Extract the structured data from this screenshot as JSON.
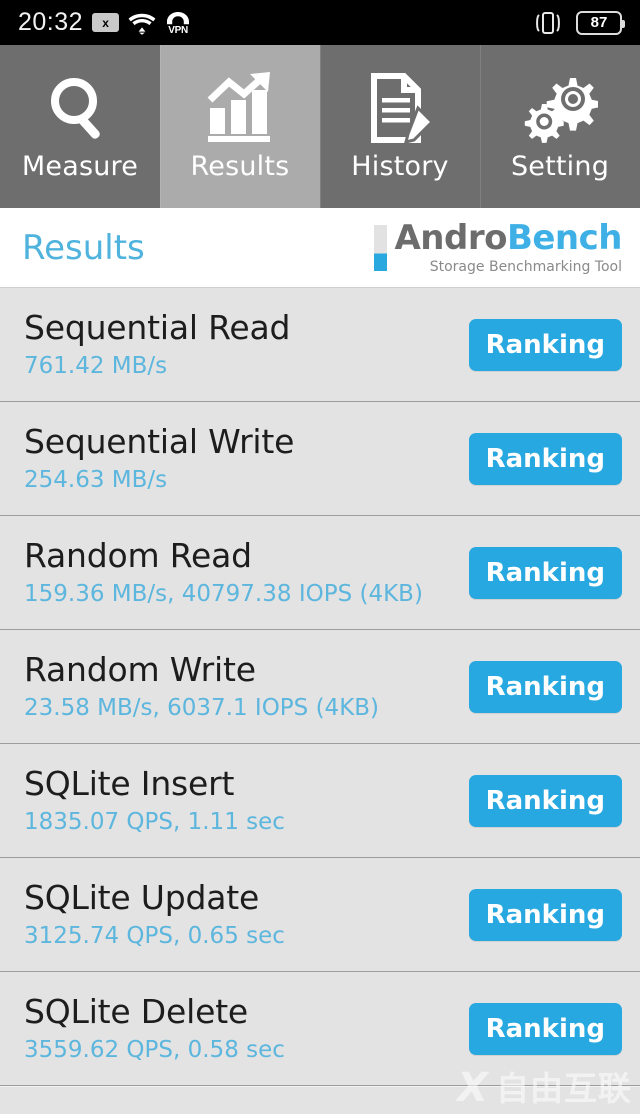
{
  "status_bar": {
    "time": "20:32",
    "x_badge": "x",
    "vpn_label": "VPN",
    "battery_level": "87",
    "icons": [
      "mute-icon",
      "wifi-icon",
      "vpn-icon",
      "vibrate-icon",
      "battery-icon"
    ]
  },
  "tabs": [
    {
      "label": "Measure",
      "icon": "magnifier-icon",
      "active": false
    },
    {
      "label": "Results",
      "icon": "bar-chart-trend-icon",
      "active": true
    },
    {
      "label": "History",
      "icon": "document-pencil-icon",
      "active": false
    },
    {
      "label": "Setting",
      "icon": "gears-icon",
      "active": false
    }
  ],
  "header": {
    "title": "Results",
    "logo_primary": "Andro",
    "logo_secondary": "Bench",
    "logo_tagline": "Storage Benchmarking Tool"
  },
  "results": [
    {
      "name": "Sequential Read",
      "value": "761.42 MB/s",
      "button": "Ranking"
    },
    {
      "name": "Sequential Write",
      "value": "254.63 MB/s",
      "button": "Ranking"
    },
    {
      "name": "Random Read",
      "value": "159.36 MB/s, 40797.38 IOPS (4KB)",
      "button": "Ranking"
    },
    {
      "name": "Random Write",
      "value": "23.58 MB/s, 6037.1 IOPS (4KB)",
      "button": "Ranking"
    },
    {
      "name": "SQLite Insert",
      "value": "1835.07 QPS, 1.11 sec",
      "button": "Ranking"
    },
    {
      "name": "SQLite Update",
      "value": "3125.74 QPS, 0.65 sec",
      "button": "Ranking"
    },
    {
      "name": "SQLite Delete",
      "value": "3559.62 QPS, 0.58 sec",
      "button": "Ranking"
    }
  ],
  "watermark": {
    "mark": "X",
    "text": "自由互联"
  },
  "colors": {
    "accent_blue": "#28a8e0",
    "title_blue": "#4fb3dd",
    "value_blue": "#5cb6dd",
    "tab_inactive": "#6e6e6e",
    "tab_active": "#ababab",
    "row_bg": "#e3e3e3"
  }
}
